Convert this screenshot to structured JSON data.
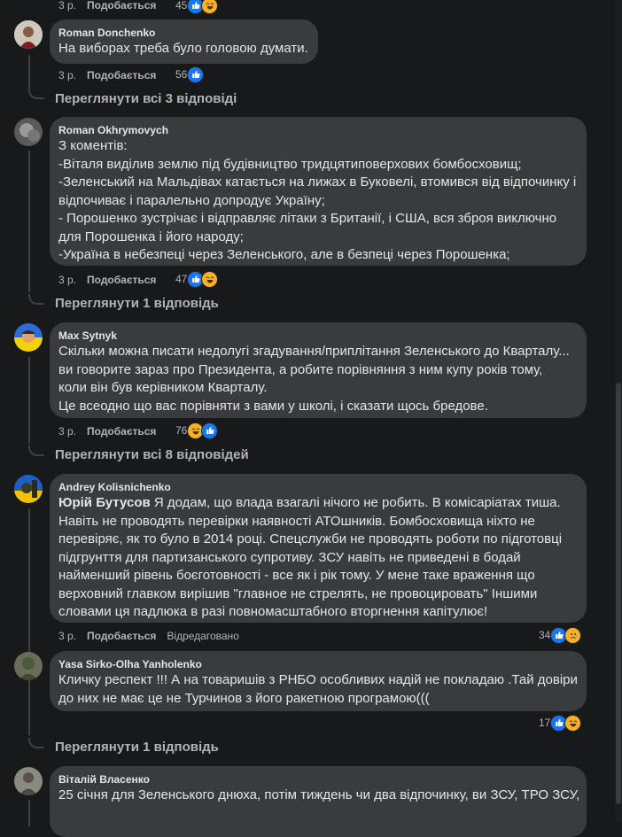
{
  "comments": [
    {
      "meta": {
        "time": "3 р.",
        "like": "Подобається"
      },
      "reactions": {
        "count": "45"
      }
    },
    {
      "name": "Roman Donchenko",
      "lines": [
        "На виборах треба було головою думати."
      ],
      "meta": {
        "time": "3 р.",
        "like": "Подобається"
      },
      "reactions": {
        "count": "56",
        "icons": [
          "like-icon"
        ]
      },
      "replies": "Переглянути всі 3 відповіді"
    },
    {
      "name": "Roman Okhrymovych",
      "lines": [
        "З коментів:",
        "-Віталя виділив землю під будівництво тридцятиповерхових бомбосховищ;",
        "-Зеленський на Мальдівах катається на лижах в Буковелі, втомився від відпочинку і",
        "відпочиває і паралельно допродує Україну;",
        "- Порошенко зустрічає і відправляє літаки з Британії, і США, вся зброя виключно",
        "для Порошенка і його народу;",
        "-Україна в небезпеці через Зеленського, але в безпеці через Порошенка;"
      ],
      "meta": {
        "time": "3 р.",
        "like": "Подобається"
      },
      "reactions": {
        "count": "47",
        "icons": [
          "like-icon",
          "haha-icon"
        ]
      },
      "replies": "Переглянути 1 відповідь"
    },
    {
      "name": "Max Sytnyk",
      "lines": [
        "Скільки можна писати недолугі згадування/приплітання Зеленського до Кварталу...",
        "ви говорите зараз про Президента, а робите порівняння з ним купу років тому,",
        "коли він був керівником Кварталу.",
        "Це всеодно що вас порівняти з вами у школі, і сказати щось бредове."
      ],
      "meta": {
        "time": "3 р.",
        "like": "Подобається"
      },
      "reactions": {
        "count": "76",
        "icons": [
          "haha-icon",
          "like-icon"
        ]
      },
      "replies": "Переглянути всі 8 відповідей"
    },
    {
      "name": "Andrey Kolisnichenko",
      "mention": "Юрій Бутусов",
      "lines": [
        " Я додам, що влада взагалі нічого не робить. В комісаріатах тиша.",
        "Навіть не проводять перевірки наявності АТОшників. Бомбосховища ніхто не",
        "перевіряє, як то було в 2014 році. Спецслужби не проводять роботи по підготовці",
        "підгрунття для партизанського супротиву. ЗСУ навіть не приведені в бодай",
        "найменший рівень боєготовності - все як і рік тому. У мене таке враження що",
        "верховний главком вирішив \"главное не стрелять, не провоцировать\" Іншими",
        "словами ця падлюка в разі повномасштабного вторгнення капітулює!"
      ],
      "meta": {
        "time": "3 р.",
        "like": "Подобається",
        "edited": "Відредаговано"
      },
      "reactions": {
        "count": "34",
        "icons": [
          "like-icon",
          "sad-icon"
        ]
      }
    },
    {
      "name": "Yasa Sirko-Olha Yanholenko",
      "lines": [
        "Кличку респект !!! А на товаришів з РНБО особливих надій не покладаю .Тай довіри",
        "до них не має це не Турчинов з його ракетною програмою((("
      ],
      "reactions": {
        "count": "17",
        "icons": [
          "like-icon",
          "haha-icon"
        ]
      },
      "replies": "Переглянути 1 відповідь"
    },
    {
      "name": "Віталій Власенко",
      "lines": [
        "25 січня для Зеленського днюха, потім тиждень чи два відпочинку, ви ЗСУ, ТРО ЗСУ,"
      ]
    }
  ],
  "colors": {
    "background": "#18191a",
    "bubble": "#3a3b3c",
    "like": "#1877f2",
    "emoji": "#f7b125",
    "muted": "#b0b3b8"
  }
}
